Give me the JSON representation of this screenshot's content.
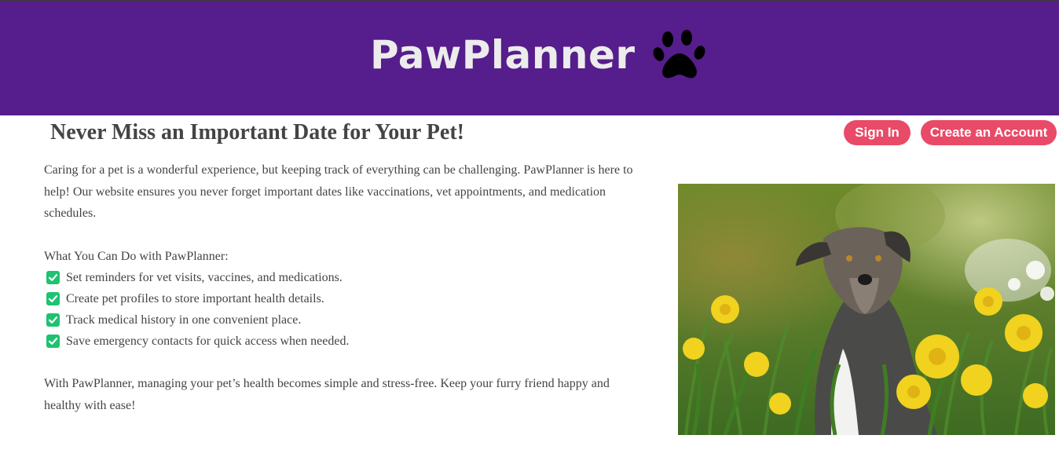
{
  "header": {
    "brand_name": "PawPlanner",
    "brand_icon": "paw-print-icon",
    "background_color": "#561d8c"
  },
  "auth": {
    "sign_in_label": "Sign In",
    "create_account_label": "Create an Account",
    "button_color": "#e84a67"
  },
  "main": {
    "headline": "Never Miss an Important Date for Your Pet!",
    "intro": "Caring for a pet is a wonderful experience, but keeping track of everything can be challenging. PawPlanner is here to help! Our website ensures you never forget important dates like vaccinations, vet appointments, and medication schedules.",
    "features_title": "What You Can Do with PawPlanner:",
    "features": [
      {
        "text": "Set reminders for vet visits, vaccines, and medications.",
        "icon": "check-icon"
      },
      {
        "text": "Create pet profiles to store important health details.",
        "icon": "check-icon"
      },
      {
        "text": "Track medical history in one convenient place.",
        "icon": "check-icon"
      },
      {
        "text": "Save emergency contacts for quick access when needed.",
        "icon": "check-icon"
      }
    ],
    "closing": "With PawPlanner, managing your pet’s health becomes simple and stress-free. Keep your furry friend happy and healthy with ease!"
  },
  "colors": {
    "check_green": "#1fc270",
    "text": "#444444"
  }
}
